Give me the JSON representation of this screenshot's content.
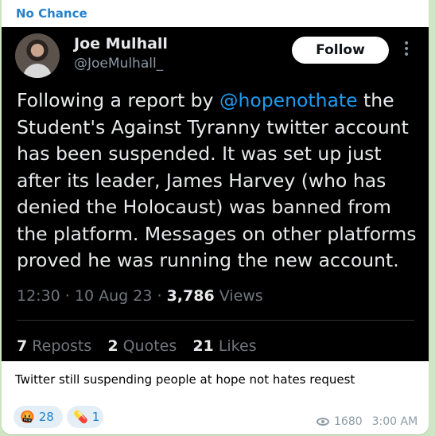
{
  "channel": {
    "name": "No Chance"
  },
  "tweet": {
    "author_name": "Joe Mulhall",
    "handle": "@JoeMulhall_",
    "follow_label": "Follow",
    "text_before": "Following a report by ",
    "mention": "@hopenothate",
    "text_after": " the Student's Against Tyranny twitter account has been suspended. It was set up just after its leader, James Harvey (who has denied the Holocaust) was banned from the platform. Messages on other platforms proved he was running the new account.",
    "time": "12:30",
    "date": "10 Aug 23",
    "views_count": "3,786",
    "views_label": "Views",
    "reposts_count": "7",
    "reposts_label": "Reposts",
    "quotes_count": "2",
    "quotes_label": "Quotes",
    "likes_count": "21",
    "likes_label": "Likes"
  },
  "message": {
    "caption": "Twitter still suspending people at hope not hates request",
    "reactions": [
      {
        "emoji": "🤬",
        "icon": "angry-face-icon",
        "count": "28"
      },
      {
        "emoji": "💊",
        "icon": "pill-icon",
        "count": "1"
      }
    ],
    "views": "1680",
    "time": "3:00 AM"
  },
  "colors": {
    "channel_accent": "#2481cc",
    "tweet_bg": "#000000",
    "mention": "#1d9bf0",
    "chat_bg": "#cfe6c4"
  }
}
